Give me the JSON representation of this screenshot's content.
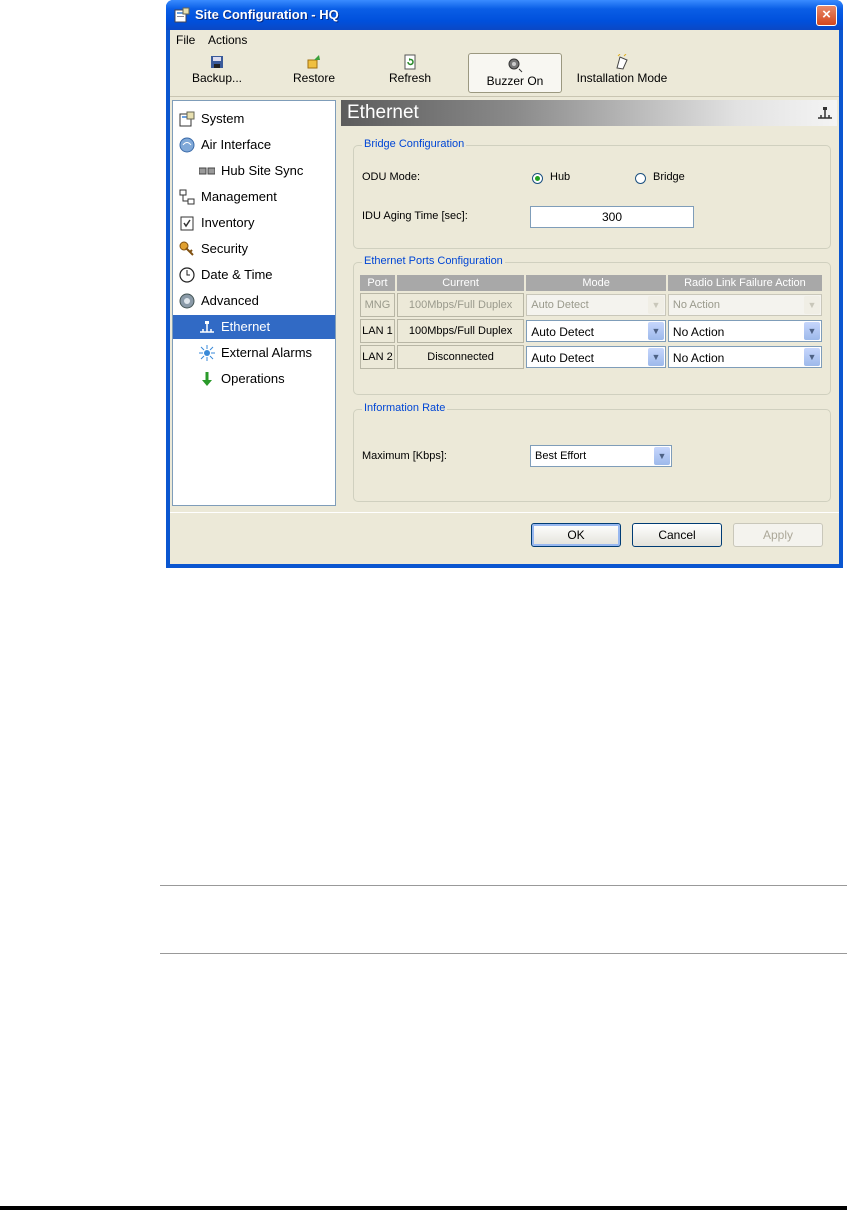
{
  "window": {
    "title": "Site Configuration - HQ",
    "close": "×"
  },
  "menu": {
    "items": [
      "File",
      "Actions"
    ]
  },
  "toolbar": {
    "backup": "Backup...",
    "restore": "Restore",
    "refresh": "Refresh",
    "buzzer": "Buzzer On",
    "installation": "Installation Mode"
  },
  "sidebar": {
    "items": [
      {
        "label": "System",
        "icon": "system-icon"
      },
      {
        "label": "Air Interface",
        "icon": "air-interface-icon"
      },
      {
        "label": "Hub Site Sync",
        "icon": "hub-site-sync-icon"
      },
      {
        "label": "Management",
        "icon": "management-icon"
      },
      {
        "label": "Inventory",
        "icon": "inventory-icon"
      },
      {
        "label": "Security",
        "icon": "security-icon"
      },
      {
        "label": "Date & Time",
        "icon": "clock-icon"
      },
      {
        "label": "Advanced",
        "icon": "gear-icon"
      },
      {
        "label": "Ethernet",
        "icon": "ethernet-icon"
      },
      {
        "label": "External Alarms",
        "icon": "alarm-icon"
      },
      {
        "label": "Operations",
        "icon": "operations-icon"
      }
    ],
    "selected": "Ethernet"
  },
  "panel": {
    "title": "Ethernet",
    "bridge": {
      "legend": "Bridge Configuration",
      "odu_mode_label": "ODU Mode:",
      "hub_label": "Hub",
      "bridge_label": "Bridge",
      "selected": "Hub",
      "aging_label": "IDU Aging Time [sec]:",
      "aging_value": "300"
    },
    "ports": {
      "legend": "Ethernet Ports Configuration",
      "headers": [
        "Port",
        "Current",
        "Mode",
        "Radio Link Failure Action"
      ],
      "rows": [
        {
          "port": "MNG",
          "current": "100Mbps/Full Duplex",
          "mode": "Auto Detect",
          "action": "No Action",
          "enabled": false
        },
        {
          "port": "LAN 1",
          "current": "100Mbps/Full Duplex",
          "mode": "Auto Detect",
          "action": "No Action",
          "enabled": true
        },
        {
          "port": "LAN 2",
          "current": "Disconnected",
          "mode": "Auto Detect",
          "action": "No Action",
          "enabled": true
        }
      ]
    },
    "info_rate": {
      "legend": "Information Rate",
      "max_label": "Maximum [Kbps]:",
      "max_value": "Best Effort"
    }
  },
  "buttons": {
    "ok": "OK",
    "cancel": "Cancel",
    "apply": "Apply"
  },
  "colors": {
    "titlebar": "#0a5ee6",
    "selection": "#316ac5",
    "legend": "#0046d5"
  }
}
